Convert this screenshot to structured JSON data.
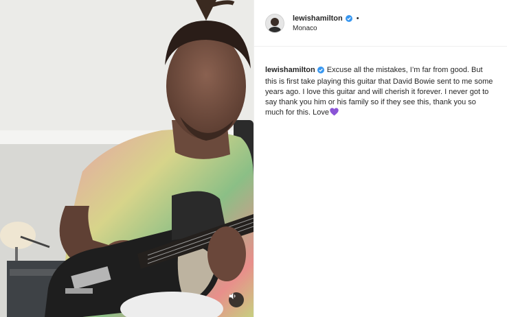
{
  "post": {
    "username": "lewishamilton",
    "location": "Monaco",
    "header_separator": "•",
    "caption_username": "lewishamilton",
    "caption_text": "Excuse all the mistakes, I’m far from good. But this is first take playing this guitar that David Bowie sent to me some years ago. I love this guitar and will cherish it forever. I never got to say thank you him or his family so if they see this, thank you so much for this. Love",
    "caption_emoji": "purple-heart-icon"
  },
  "icons": {
    "verified": "verified-badge-icon",
    "sound": "speaker-icon"
  },
  "colors": {
    "verified_blue": "#3897f0",
    "heart_purple": "#8a54d6",
    "text": "#262626",
    "divider": "#efefef"
  }
}
